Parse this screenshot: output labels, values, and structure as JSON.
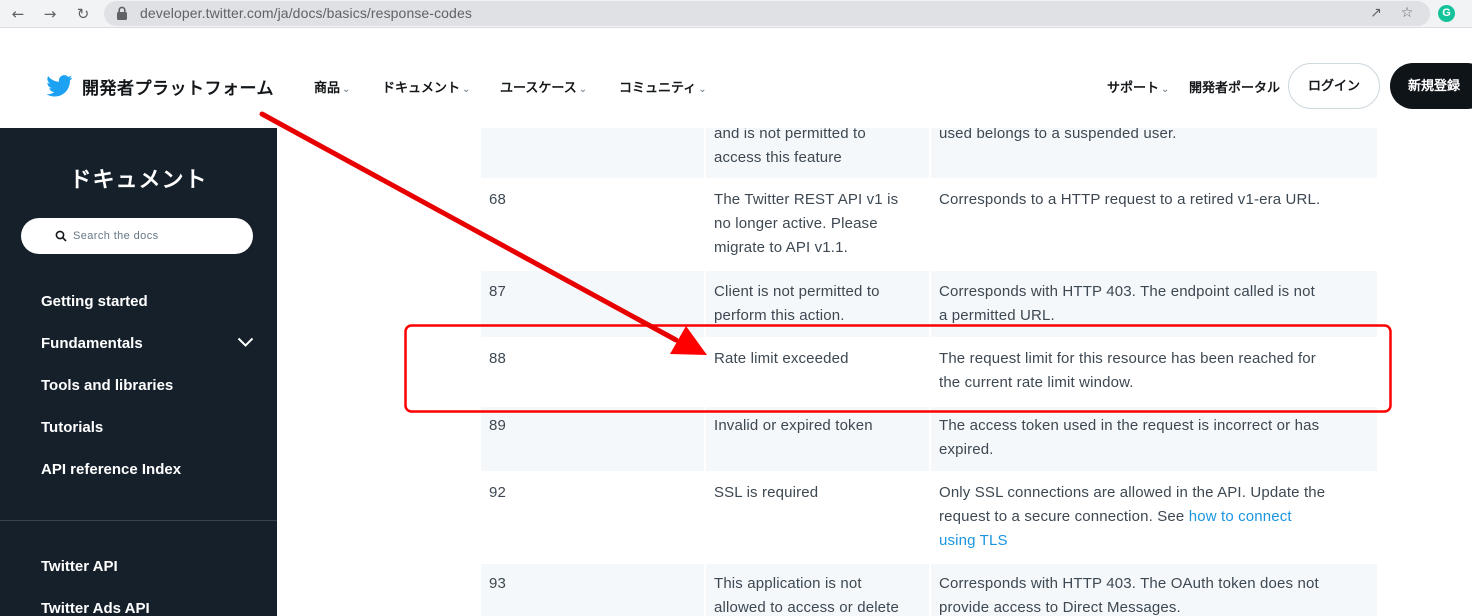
{
  "browser": {
    "back_icon": "arrow-left-icon",
    "forward_icon": "arrow-right-icon",
    "reload_icon": "reload-icon",
    "url": "developer.twitter.com/ja/docs/basics/response-codes",
    "share_icon": "share-icon",
    "bookmark_icon": "star-icon",
    "extension_badge": "G",
    "extension_color": "#15c39a"
  },
  "header": {
    "brand": "開発者プラットフォーム",
    "nav": [
      {
        "label": "商品"
      },
      {
        "label": "ドキュメント"
      },
      {
        "label": "ユースケース"
      },
      {
        "label": "コミュニティ"
      }
    ],
    "support": "サポート",
    "portal": "開発者ポータル",
    "login": "ログイン",
    "signup": "新規登録",
    "brand_color": "#1da1f2"
  },
  "sidebar": {
    "title": "ドキュメント",
    "search_placeholder": "Search the docs",
    "items": [
      {
        "label": "Getting started"
      },
      {
        "label": "Fundamentals"
      },
      {
        "label": "Tools and libraries"
      },
      {
        "label": "Tutorials"
      },
      {
        "label": "API reference Index"
      }
    ],
    "products": [
      {
        "label": "Twitter API"
      },
      {
        "label": "Twitter Ads API"
      }
    ],
    "background": "#15202b"
  },
  "table": {
    "rows": [
      {
        "code": "",
        "text": "and is not permitted to\naccess this feature",
        "description": "used belongs to a suspended user."
      },
      {
        "code": "68",
        "text": "The Twitter REST API v1 is\nno longer active. Please\nmigrate to API v1.1.",
        "description": "Corresponds to a HTTP request to a retired v1-era URL."
      },
      {
        "code": "87",
        "text": "Client is not permitted to\nperform this action.",
        "description": "Corresponds with HTTP 403. The endpoint called is not\na permitted URL."
      },
      {
        "code": "88",
        "text": "Rate limit exceeded",
        "description": "The request limit for this resource has been reached for\nthe current rate limit window."
      },
      {
        "code": "89",
        "text": "Invalid or expired token",
        "description": "The access token used in the request is incorrect or has\nexpired."
      },
      {
        "code": "92",
        "text": "SSL is required",
        "description": "Only SSL connections are allowed in the API. Update the\nrequest to a secure connection. See ",
        "link1": "how to connect",
        "link2": "using TLS"
      },
      {
        "code": "93",
        "text": "This application is not\nallowed to access or delete",
        "description": "Corresponds with HTTP 403. The OAuth token does not\nprovide access to Direct Messages."
      }
    ],
    "row_background": "#f5f8fa",
    "link_color": "#1b95e0"
  },
  "annotation": {
    "color": "#ff0000",
    "arrow": "arrow pointing to the row with code 88",
    "highlight": "box around the row with code 88"
  }
}
